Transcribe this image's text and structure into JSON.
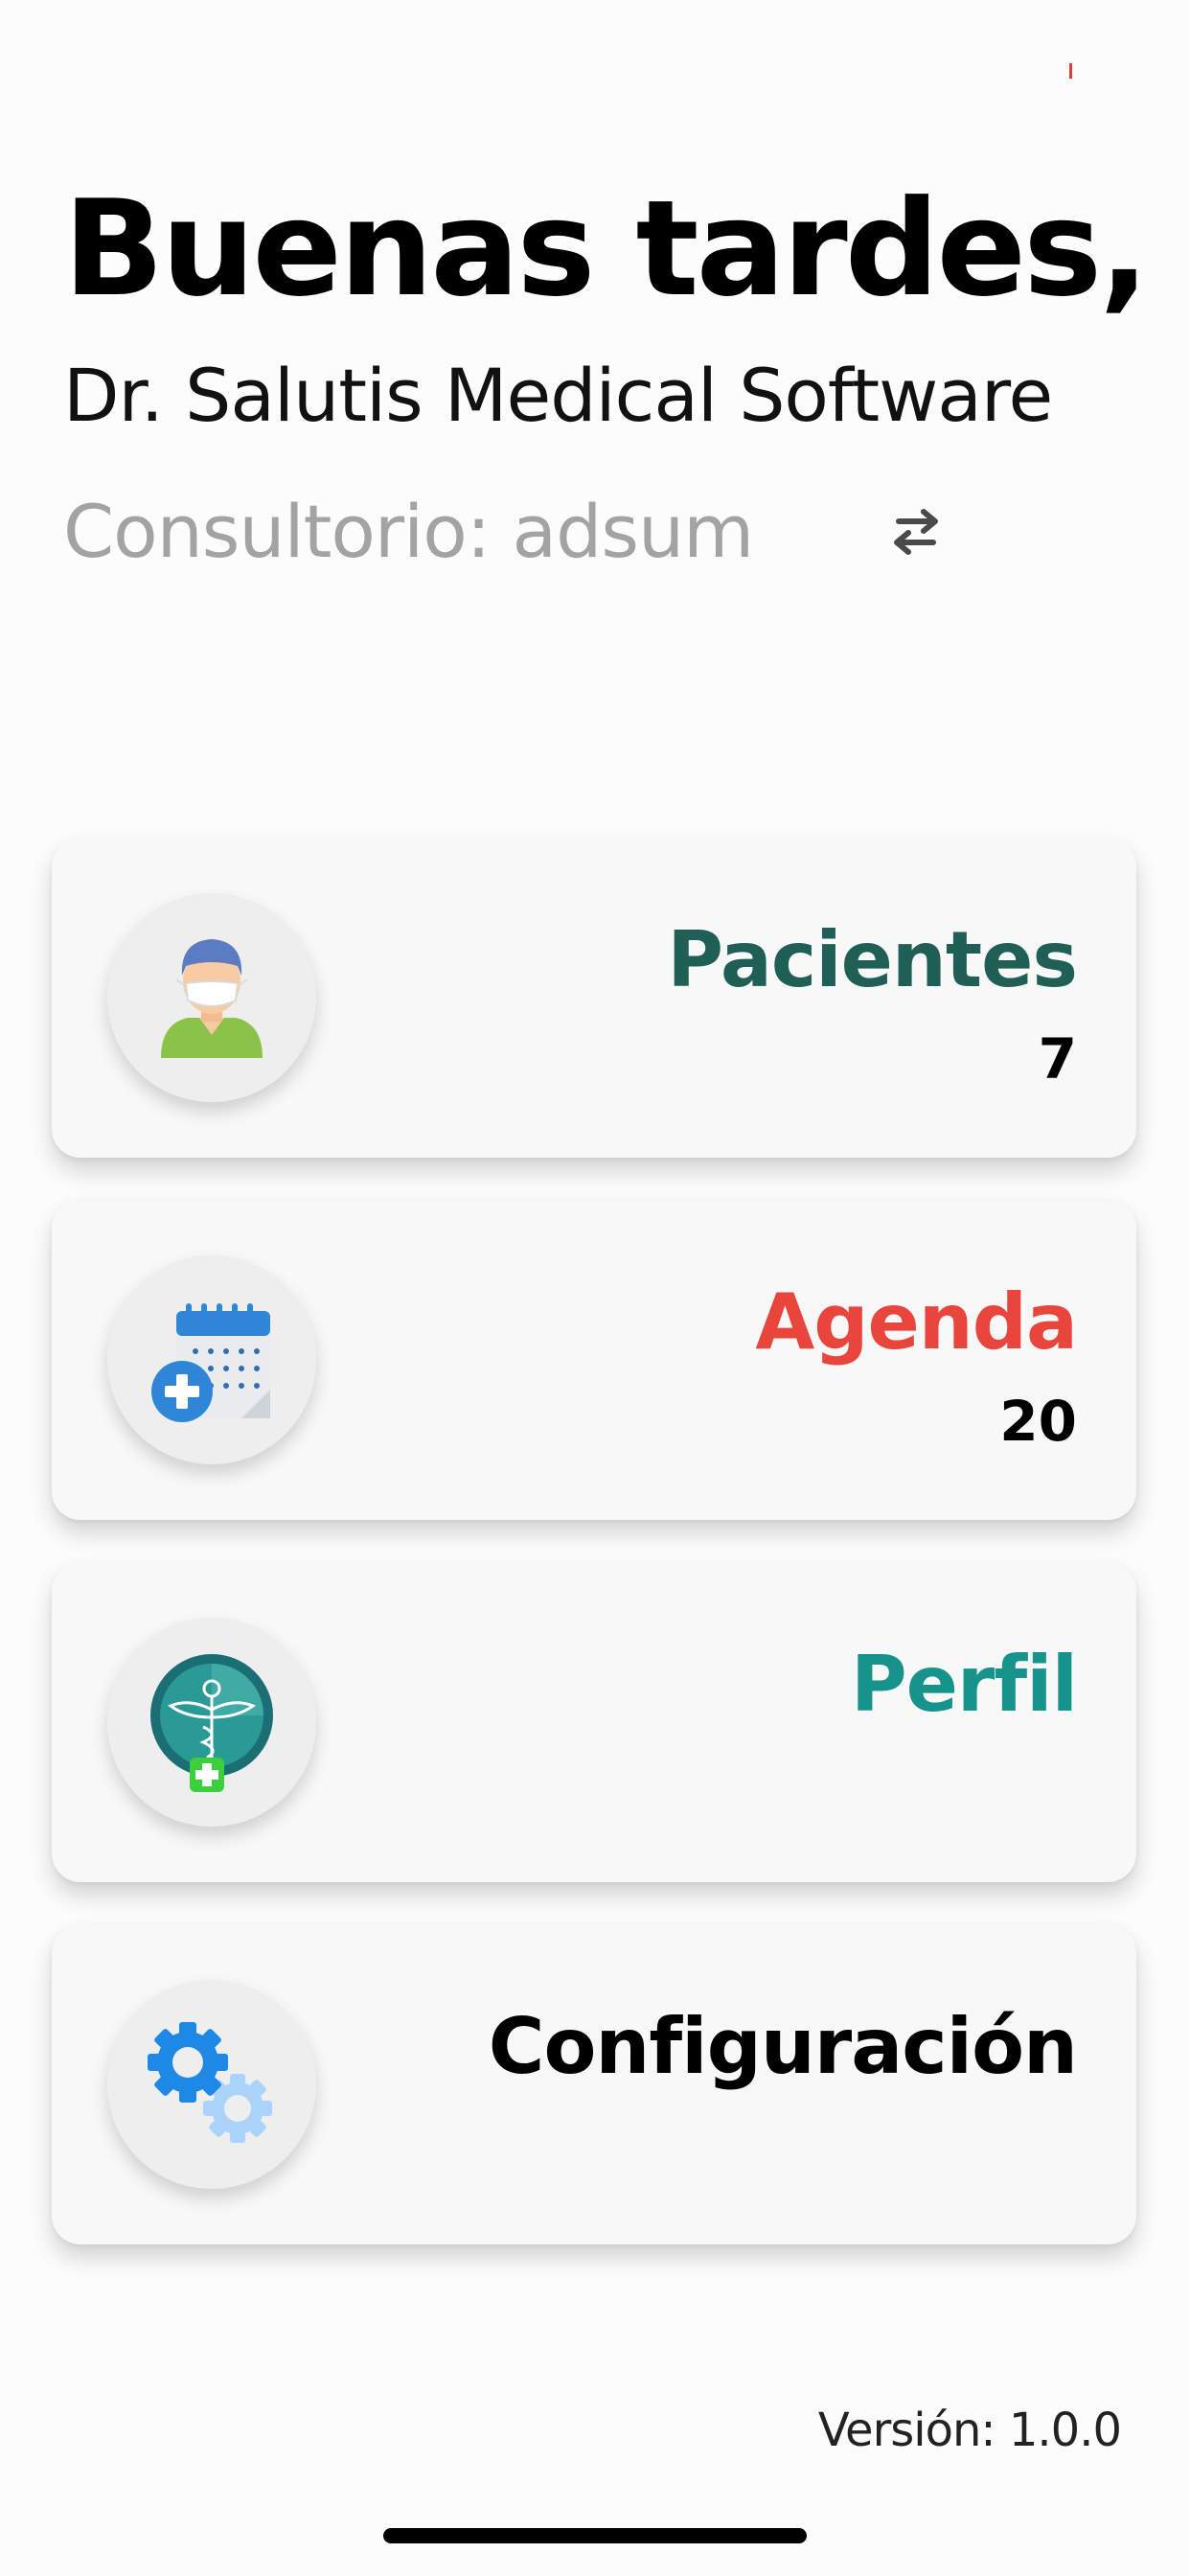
{
  "header": {
    "greeting": "Buenas tardes,",
    "doctor_name": "Dr. Salutis Medical Software",
    "office": "Consultorio: adsum",
    "switch_icon": "swap-arrows-icon"
  },
  "menu": [
    {
      "title": "Pacientes",
      "count": "7",
      "color": "#1f5f56",
      "icon": "doctor-avatar-icon"
    },
    {
      "title": "Agenda",
      "count": "20",
      "color": "#e8453c",
      "icon": "calendar-add-icon"
    },
    {
      "title": "Perfil",
      "count": "",
      "color": "#16938a",
      "icon": "caduceus-icon"
    },
    {
      "title": "Configuración",
      "count": "",
      "color": "#000000",
      "icon": "gears-icon"
    }
  ],
  "footer": {
    "version": "Versión: 1.0.0"
  }
}
